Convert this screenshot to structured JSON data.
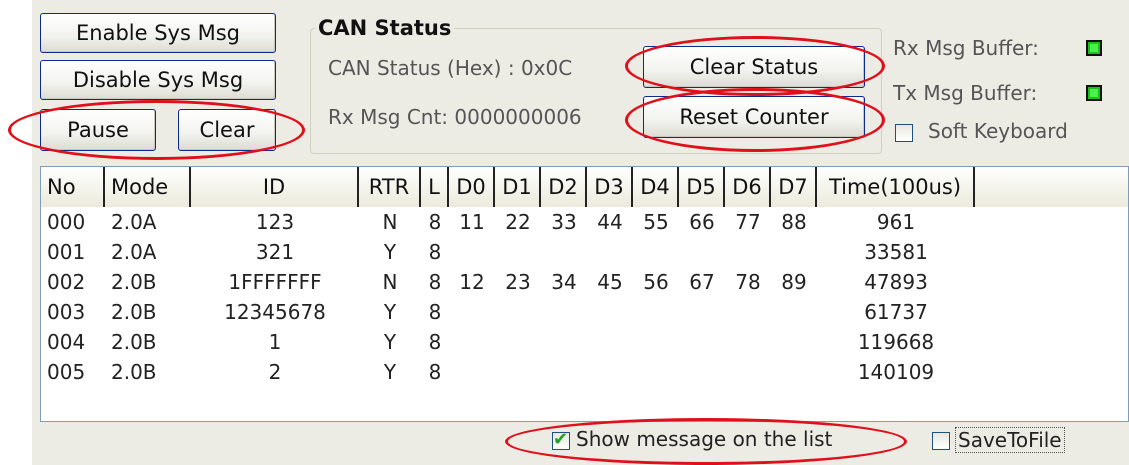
{
  "buttons": {
    "enable_sys_msg": "Enable Sys Msg",
    "disable_sys_msg": "Disable Sys Msg",
    "pause": "Pause",
    "clear": "Clear",
    "clear_status": "Clear Status",
    "reset_counter": "Reset Counter"
  },
  "can_status": {
    "title": "CAN Status",
    "status_hex_label": "CAN Status (Hex) :  0x0C",
    "rx_msg_cnt_label": "Rx Msg Cnt: 0000000006"
  },
  "indicators": {
    "rx_buffer_label": "Rx Msg Buffer:",
    "tx_buffer_label": "Tx Msg Buffer:",
    "soft_keyboard_label": "Soft Keyboard",
    "led_color": "#18c318"
  },
  "table": {
    "columns": [
      "No",
      "Mode",
      "ID",
      "RTR",
      "L",
      "D0",
      "D1",
      "D2",
      "D3",
      "D4",
      "D5",
      "D6",
      "D7",
      "Time(100us)"
    ],
    "rows": [
      [
        "000",
        "2.0A",
        "123",
        "N",
        "8",
        "11",
        "22",
        "33",
        "44",
        "55",
        "66",
        "77",
        "88",
        "961"
      ],
      [
        "001",
        "2.0A",
        "321",
        "Y",
        "8",
        "",
        "",
        "",
        "",
        "",
        "",
        "",
        "",
        "33581"
      ],
      [
        "002",
        "2.0B",
        "1FFFFFFF",
        "N",
        "8",
        "12",
        "23",
        "34",
        "45",
        "56",
        "67",
        "78",
        "89",
        "47893"
      ],
      [
        "003",
        "2.0B",
        "12345678",
        "Y",
        "8",
        "",
        "",
        "",
        "",
        "",
        "",
        "",
        "",
        "61737"
      ],
      [
        "004",
        "2.0B",
        "1",
        "Y",
        "8",
        "",
        "",
        "",
        "",
        "",
        "",
        "",
        "",
        "119668"
      ],
      [
        "005",
        "2.0B",
        "2",
        "Y",
        "8",
        "",
        "",
        "",
        "",
        "",
        "",
        "",
        "",
        "140109"
      ]
    ]
  },
  "footer": {
    "show_message_label": "Show message on the list",
    "show_message_checked": true,
    "save_to_file_label": "SaveToFile",
    "save_to_file_checked": false
  },
  "highlight_color": "#e0101b"
}
